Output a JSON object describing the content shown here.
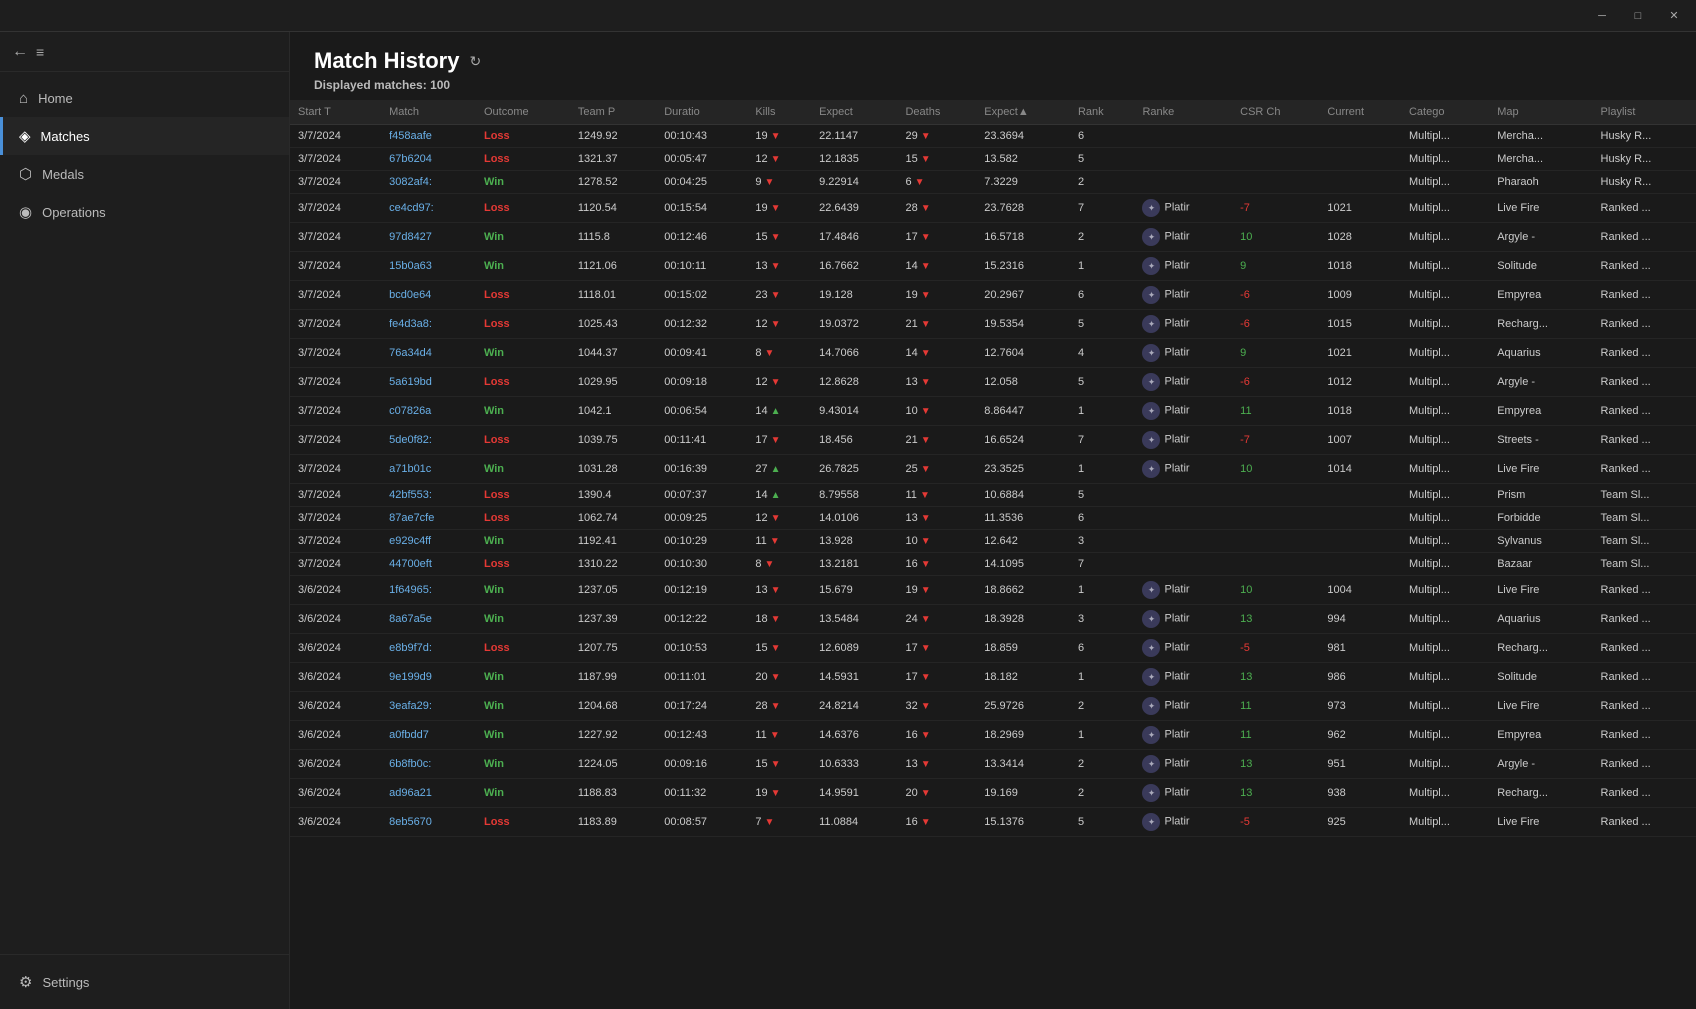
{
  "titlebar": {
    "minimize_label": "─",
    "maximize_label": "□",
    "close_label": "✕"
  },
  "sidebar": {
    "hamburger": "≡",
    "back": "←",
    "items": [
      {
        "id": "home",
        "label": "Home",
        "icon": "⌂",
        "active": false
      },
      {
        "id": "matches",
        "label": "Matches",
        "icon": "◈",
        "active": true
      },
      {
        "id": "medals",
        "label": "Medals",
        "icon": "⬡",
        "active": false
      },
      {
        "id": "operations",
        "label": "Operations",
        "icon": "◉",
        "active": false
      }
    ],
    "bottom_items": [
      {
        "id": "settings",
        "label": "Settings",
        "icon": "⚙"
      }
    ]
  },
  "main": {
    "title": "Match History",
    "refresh_icon": "↻",
    "subtitle_prefix": "Displayed matches:",
    "subtitle_count": "100",
    "columns": [
      "Start T",
      "Match",
      "Outcome",
      "Team P",
      "Duratio",
      "Kills",
      "Expect",
      "Deaths",
      "Expect▲",
      "Rank",
      "Ranke",
      "CSR Ch",
      "Current",
      "Catego",
      "Map",
      "Playlist"
    ],
    "rows": [
      {
        "date": "3/7/2024",
        "match": "f458aafe",
        "outcome": "Loss",
        "team": "1249.92",
        "duration": "00:10:43",
        "kills": "19",
        "kill_arr": "down",
        "expected_k": "22.1147",
        "deaths": "29",
        "death_arr": "down",
        "expected_d": "23.3694",
        "rank": "6",
        "rank_icon": false,
        "rank_label": "",
        "csr_change": "",
        "current_csr": "",
        "category": "Multipl...",
        "map": "Mercha...",
        "playlist": "Husky R..."
      },
      {
        "date": "3/7/2024",
        "match": "67b6204",
        "outcome": "Loss",
        "team": "1321.37",
        "duration": "00:05:47",
        "kills": "12",
        "kill_arr": "down",
        "expected_k": "12.1835",
        "deaths": "15",
        "death_arr": "down",
        "expected_d": "13.582",
        "rank": "5",
        "rank_icon": false,
        "rank_label": "",
        "csr_change": "",
        "current_csr": "",
        "category": "Multipl...",
        "map": "Mercha...",
        "playlist": "Husky R..."
      },
      {
        "date": "3/7/2024",
        "match": "3082af4:",
        "outcome": "Win",
        "team": "1278.52",
        "duration": "00:04:25",
        "kills": "9",
        "kill_arr": "down",
        "expected_k": "9.22914",
        "deaths": "6",
        "death_arr": "down",
        "expected_d": "7.3229",
        "rank": "2",
        "rank_icon": false,
        "rank_label": "",
        "csr_change": "",
        "current_csr": "",
        "category": "Multipl...",
        "map": "Pharaoh",
        "playlist": "Husky R..."
      },
      {
        "date": "3/7/2024",
        "match": "ce4cd97:",
        "outcome": "Loss",
        "team": "1120.54",
        "duration": "00:15:54",
        "kills": "19",
        "kill_arr": "down",
        "expected_k": "22.6439",
        "deaths": "28",
        "death_arr": "down",
        "expected_d": "23.7628",
        "rank": "7",
        "rank_icon": true,
        "rank_label": "Platir",
        "csr_change": "-7",
        "current_csr": "1021",
        "category": "Multipl...",
        "map": "Live Fire",
        "playlist": "Ranked ..."
      },
      {
        "date": "3/7/2024",
        "match": "97d8427",
        "outcome": "Win",
        "team": "1115.8",
        "duration": "00:12:46",
        "kills": "15",
        "kill_arr": "down",
        "expected_k": "17.4846",
        "deaths": "17",
        "death_arr": "down",
        "expected_d": "16.5718",
        "rank": "2",
        "rank_icon": true,
        "rank_label": "Platir",
        "csr_change": "10",
        "current_csr": "1028",
        "category": "Multipl...",
        "map": "Argyle -",
        "playlist": "Ranked ..."
      },
      {
        "date": "3/7/2024",
        "match": "15b0a63",
        "outcome": "Win",
        "team": "1121.06",
        "duration": "00:10:11",
        "kills": "13",
        "kill_arr": "down",
        "expected_k": "16.7662",
        "deaths": "14",
        "death_arr": "down",
        "expected_d": "15.2316",
        "rank": "1",
        "rank_icon": true,
        "rank_label": "Platir",
        "csr_change": "9",
        "current_csr": "1018",
        "category": "Multipl...",
        "map": "Solitude",
        "playlist": "Ranked ..."
      },
      {
        "date": "3/7/2024",
        "match": "bcd0e64",
        "outcome": "Loss",
        "team": "1118.01",
        "duration": "00:15:02",
        "kills": "23",
        "kill_arr": "down",
        "expected_k": "19.128",
        "deaths": "19",
        "death_arr": "down",
        "expected_d": "20.2967",
        "rank": "6",
        "rank_icon": true,
        "rank_label": "Platir",
        "csr_change": "-6",
        "current_csr": "1009",
        "category": "Multipl...",
        "map": "Empyrea",
        "playlist": "Ranked ..."
      },
      {
        "date": "3/7/2024",
        "match": "fe4d3a8:",
        "outcome": "Loss",
        "team": "1025.43",
        "duration": "00:12:32",
        "kills": "12",
        "kill_arr": "down",
        "expected_k": "19.0372",
        "deaths": "21",
        "death_arr": "down",
        "expected_d": "19.5354",
        "rank": "5",
        "rank_icon": true,
        "rank_label": "Platir",
        "csr_change": "-6",
        "current_csr": "1015",
        "category": "Multipl...",
        "map": "Recharg...",
        "playlist": "Ranked ..."
      },
      {
        "date": "3/7/2024",
        "match": "76a34d4",
        "outcome": "Win",
        "team": "1044.37",
        "duration": "00:09:41",
        "kills": "8",
        "kill_arr": "down",
        "expected_k": "14.7066",
        "deaths": "14",
        "death_arr": "down",
        "expected_d": "12.7604",
        "rank": "4",
        "rank_icon": true,
        "rank_label": "Platir",
        "csr_change": "9",
        "current_csr": "1021",
        "category": "Multipl...",
        "map": "Aquarius",
        "playlist": "Ranked ..."
      },
      {
        "date": "3/7/2024",
        "match": "5a619bd",
        "outcome": "Loss",
        "team": "1029.95",
        "duration": "00:09:18",
        "kills": "12",
        "kill_arr": "down",
        "expected_k": "12.8628",
        "deaths": "13",
        "death_arr": "down",
        "expected_d": "12.058",
        "rank": "5",
        "rank_icon": true,
        "rank_label": "Platir",
        "csr_change": "-6",
        "current_csr": "1012",
        "category": "Multipl...",
        "map": "Argyle -",
        "playlist": "Ranked ..."
      },
      {
        "date": "3/7/2024",
        "match": "c07826a",
        "outcome": "Win",
        "team": "1042.1",
        "duration": "00:06:54",
        "kills": "14",
        "kill_arr": "up",
        "expected_k": "9.43014",
        "deaths": "10",
        "death_arr": "down",
        "expected_d": "8.86447",
        "rank": "1",
        "rank_icon": true,
        "rank_label": "Platir",
        "csr_change": "11",
        "current_csr": "1018",
        "category": "Multipl...",
        "map": "Empyrea",
        "playlist": "Ranked ..."
      },
      {
        "date": "3/7/2024",
        "match": "5de0f82:",
        "outcome": "Loss",
        "team": "1039.75",
        "duration": "00:11:41",
        "kills": "17",
        "kill_arr": "down",
        "expected_k": "18.456",
        "deaths": "21",
        "death_arr": "down",
        "expected_d": "16.6524",
        "rank": "7",
        "rank_icon": true,
        "rank_label": "Platir",
        "csr_change": "-7",
        "current_csr": "1007",
        "category": "Multipl...",
        "map": "Streets -",
        "playlist": "Ranked ..."
      },
      {
        "date": "3/7/2024",
        "match": "a71b01c",
        "outcome": "Win",
        "team": "1031.28",
        "duration": "00:16:39",
        "kills": "27",
        "kill_arr": "up",
        "expected_k": "26.7825",
        "deaths": "25",
        "death_arr": "down",
        "expected_d": "23.3525",
        "rank": "1",
        "rank_icon": true,
        "rank_label": "Platir",
        "csr_change": "10",
        "current_csr": "1014",
        "category": "Multipl...",
        "map": "Live Fire",
        "playlist": "Ranked ..."
      },
      {
        "date": "3/7/2024",
        "match": "42bf553:",
        "outcome": "Loss",
        "team": "1390.4",
        "duration": "00:07:37",
        "kills": "14",
        "kill_arr": "up",
        "expected_k": "8.79558",
        "deaths": "11",
        "death_arr": "down",
        "expected_d": "10.6884",
        "rank": "5",
        "rank_icon": false,
        "rank_label": "",
        "csr_change": "",
        "current_csr": "",
        "category": "Multipl...",
        "map": "Prism",
        "playlist": "Team Sl..."
      },
      {
        "date": "3/7/2024",
        "match": "87ae7cfe",
        "outcome": "Loss",
        "team": "1062.74",
        "duration": "00:09:25",
        "kills": "12",
        "kill_arr": "down",
        "expected_k": "14.0106",
        "deaths": "13",
        "death_arr": "down",
        "expected_d": "11.3536",
        "rank": "6",
        "rank_icon": false,
        "rank_label": "",
        "csr_change": "",
        "current_csr": "",
        "category": "Multipl...",
        "map": "Forbidde",
        "playlist": "Team Sl..."
      },
      {
        "date": "3/7/2024",
        "match": "e929c4ff",
        "outcome": "Win",
        "team": "1192.41",
        "duration": "00:10:29",
        "kills": "11",
        "kill_arr": "down",
        "expected_k": "13.928",
        "deaths": "10",
        "death_arr": "down",
        "expected_d": "12.642",
        "rank": "3",
        "rank_icon": false,
        "rank_label": "",
        "csr_change": "",
        "current_csr": "",
        "category": "Multipl...",
        "map": "Sylvanus",
        "playlist": "Team Sl..."
      },
      {
        "date": "3/7/2024",
        "match": "44700eft",
        "outcome": "Loss",
        "team": "1310.22",
        "duration": "00:10:30",
        "kills": "8",
        "kill_arr": "down",
        "expected_k": "13.2181",
        "deaths": "16",
        "death_arr": "down",
        "expected_d": "14.1095",
        "rank": "7",
        "rank_icon": false,
        "rank_label": "",
        "csr_change": "",
        "current_csr": "",
        "category": "Multipl...",
        "map": "Bazaar",
        "playlist": "Team Sl..."
      },
      {
        "date": "3/6/2024",
        "match": "1f64965:",
        "outcome": "Win",
        "team": "1237.05",
        "duration": "00:12:19",
        "kills": "13",
        "kill_arr": "down",
        "expected_k": "15.679",
        "deaths": "19",
        "death_arr": "down",
        "expected_d": "18.8662",
        "rank": "1",
        "rank_icon": true,
        "rank_label": "Platir",
        "csr_change": "10",
        "current_csr": "1004",
        "category": "Multipl...",
        "map": "Live Fire",
        "playlist": "Ranked ..."
      },
      {
        "date": "3/6/2024",
        "match": "8a67a5e",
        "outcome": "Win",
        "team": "1237.39",
        "duration": "00:12:22",
        "kills": "18",
        "kill_arr": "down",
        "expected_k": "13.5484",
        "deaths": "24",
        "death_arr": "down",
        "expected_d": "18.3928",
        "rank": "3",
        "rank_icon": true,
        "rank_label": "Platir",
        "csr_change": "13",
        "current_csr": "994",
        "category": "Multipl...",
        "map": "Aquarius",
        "playlist": "Ranked ..."
      },
      {
        "date": "3/6/2024",
        "match": "e8b9f7d:",
        "outcome": "Loss",
        "team": "1207.75",
        "duration": "00:10:53",
        "kills": "15",
        "kill_arr": "down",
        "expected_k": "12.6089",
        "deaths": "17",
        "death_arr": "down",
        "expected_d": "18.859",
        "rank": "6",
        "rank_icon": true,
        "rank_label": "Platir",
        "csr_change": "-5",
        "current_csr": "981",
        "category": "Multipl...",
        "map": "Recharg...",
        "playlist": "Ranked ..."
      },
      {
        "date": "3/6/2024",
        "match": "9e199d9",
        "outcome": "Win",
        "team": "1187.99",
        "duration": "00:11:01",
        "kills": "20",
        "kill_arr": "down",
        "expected_k": "14.5931",
        "deaths": "17",
        "death_arr": "down",
        "expected_d": "18.182",
        "rank": "1",
        "rank_icon": true,
        "rank_label": "Platir",
        "csr_change": "13",
        "current_csr": "986",
        "category": "Multipl...",
        "map": "Solitude",
        "playlist": "Ranked ..."
      },
      {
        "date": "3/6/2024",
        "match": "3eafa29:",
        "outcome": "Win",
        "team": "1204.68",
        "duration": "00:17:24",
        "kills": "28",
        "kill_arr": "down",
        "expected_k": "24.8214",
        "deaths": "32",
        "death_arr": "down",
        "expected_d": "25.9726",
        "rank": "2",
        "rank_icon": true,
        "rank_label": "Platir",
        "csr_change": "11",
        "current_csr": "973",
        "category": "Multipl...",
        "map": "Live Fire",
        "playlist": "Ranked ..."
      },
      {
        "date": "3/6/2024",
        "match": "a0fbdd7",
        "outcome": "Win",
        "team": "1227.92",
        "duration": "00:12:43",
        "kills": "11",
        "kill_arr": "down",
        "expected_k": "14.6376",
        "deaths": "16",
        "death_arr": "down",
        "expected_d": "18.2969",
        "rank": "1",
        "rank_icon": true,
        "rank_label": "Platir",
        "csr_change": "11",
        "current_csr": "962",
        "category": "Multipl...",
        "map": "Empyrea",
        "playlist": "Ranked ..."
      },
      {
        "date": "3/6/2024",
        "match": "6b8fb0c:",
        "outcome": "Win",
        "team": "1224.05",
        "duration": "00:09:16",
        "kills": "15",
        "kill_arr": "down",
        "expected_k": "10.6333",
        "deaths": "13",
        "death_arr": "down",
        "expected_d": "13.3414",
        "rank": "2",
        "rank_icon": true,
        "rank_label": "Platir",
        "csr_change": "13",
        "current_csr": "951",
        "category": "Multipl...",
        "map": "Argyle -",
        "playlist": "Ranked ..."
      },
      {
        "date": "3/6/2024",
        "match": "ad96a21",
        "outcome": "Win",
        "team": "1188.83",
        "duration": "00:11:32",
        "kills": "19",
        "kill_arr": "down",
        "expected_k": "14.9591",
        "deaths": "20",
        "death_arr": "down",
        "expected_d": "19.169",
        "rank": "2",
        "rank_icon": true,
        "rank_label": "Platir",
        "csr_change": "13",
        "current_csr": "938",
        "category": "Multipl...",
        "map": "Recharg...",
        "playlist": "Ranked ..."
      },
      {
        "date": "3/6/2024",
        "match": "8eb5670",
        "outcome": "Loss",
        "team": "1183.89",
        "duration": "00:08:57",
        "kills": "7",
        "kill_arr": "down",
        "expected_k": "11.0884",
        "deaths": "16",
        "death_arr": "down",
        "expected_d": "15.1376",
        "rank": "5",
        "rank_icon": true,
        "rank_label": "Platir",
        "csr_change": "-5",
        "current_csr": "925",
        "category": "Multipl...",
        "map": "Live Fire",
        "playlist": "Ranked ..."
      }
    ]
  }
}
